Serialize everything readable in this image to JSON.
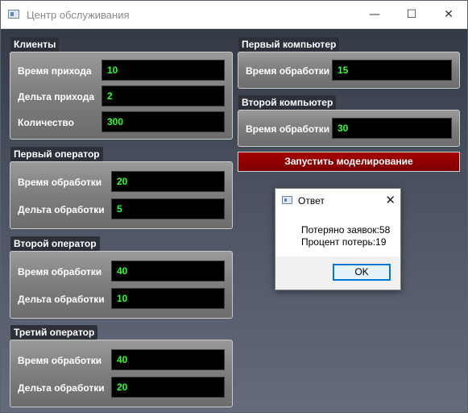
{
  "window": {
    "title": "Центр обслуживания",
    "minimize_glyph": "—",
    "maximize_glyph": "☐",
    "close_glyph": "✕"
  },
  "clients": {
    "title": "Клиенты",
    "arrival_time_label": "Время прихода",
    "arrival_time_value": "10",
    "arrival_delta_label": "Дельта прихода",
    "arrival_delta_value": "2",
    "count_label": "Количество",
    "count_value": "300"
  },
  "operators": [
    {
      "title": "Первый оператор",
      "time_label": "Время обработки",
      "time_value": "20",
      "delta_label": "Дельта обработки",
      "delta_value": "5"
    },
    {
      "title": "Второй оператор",
      "time_label": "Время обработки",
      "time_value": "40",
      "delta_label": "Дельта обработки",
      "delta_value": "10"
    },
    {
      "title": "Третий оператор",
      "time_label": "Время обработки",
      "time_value": "40",
      "delta_label": "Дельта обработки",
      "delta_value": "20"
    }
  ],
  "computers": [
    {
      "title": "Первый компьютер",
      "time_label": "Время обработки",
      "time_value": "15"
    },
    {
      "title": "Второй компьютер",
      "time_label": "Время обработки",
      "time_value": "30"
    }
  ],
  "run_button_label": "Запустить моделирование",
  "dialog": {
    "title": "Ответ",
    "close_glyph": "✕",
    "line1": "Потеряно заявок:58",
    "line2": "Процент потерь:19",
    "ok_label": "OK"
  },
  "colors": {
    "field_text": "#2cff2c",
    "run_button": "#8b0000",
    "dialog_ok_border": "#0078d7"
  }
}
